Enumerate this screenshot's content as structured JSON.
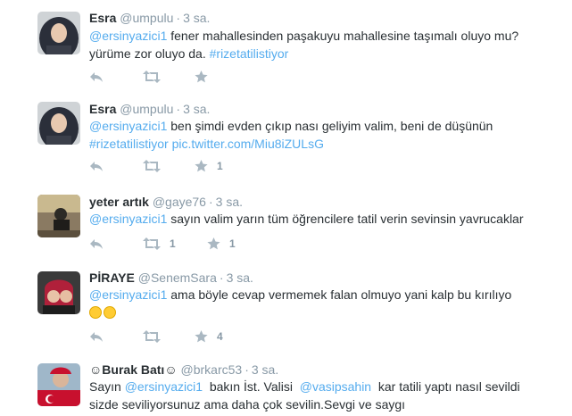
{
  "tweets": [
    {
      "fullname": "Esra",
      "username": "@umpulu",
      "time": "3 sa.",
      "line1": {
        "mention": "@ersinyazici1",
        "text": " fener mahallesinden paşakuyu mahallesine taşımalı oluyo mu?"
      },
      "line2": {
        "text": "yürüme zor oluyo da. ",
        "hashtag": "#rizetatilistiyor"
      },
      "retweets": "",
      "favorites": ""
    },
    {
      "fullname": "Esra",
      "username": "@umpulu",
      "time": "3 sa.",
      "line1": {
        "mention": "@ersinyazici1",
        "text": " ben şimdi evden çıkıp nası geliyim valim, beni de düşünün"
      },
      "line2": {
        "hashtag": "#rizetatilistiyor",
        "link": "pic.twitter.com/Miu8iZULsG"
      },
      "retweets": "",
      "favorites": "1"
    },
    {
      "fullname": "yeter artık",
      "username": "@gaye76",
      "time": "3 sa.",
      "line1": {
        "mention": "@ersinyazici1",
        "text": " sayın valim yarın tüm öğrencilere tatil verin sevinsin yavrucaklar"
      },
      "retweets": "1",
      "favorites": "1"
    },
    {
      "fullname": "PİRAYE",
      "username": "@SenemSara",
      "time": "3 sa.",
      "line1": {
        "mention": "@ersinyazici1",
        "text": " ama böyle cevap vermemek falan olmuyo yani kalp bu kırılıyo"
      },
      "retweets": "",
      "favorites": "4"
    },
    {
      "fullname": "☺Burak Batı☺",
      "username": "@brkarc53",
      "time": "3 sa.",
      "line1": {
        "prefix": "Sayın ",
        "mention": "@ersinyazici1",
        "mid": "  bakın İst. Valisi  ",
        "mention2": "@vasipsahin",
        "text": "  kar tatili yaptı nasıl sevildi"
      },
      "line2": {
        "text": "sizde seviliyorsunuz ama daha çok sevilin.Sevgi ve saygı"
      }
    }
  ],
  "icons": {
    "reply": "reply-icon",
    "retweet": "retweet-icon",
    "favorite": "star-icon"
  },
  "colors": {
    "link": "#55acee",
    "muted": "#8899a6",
    "text": "#292f33"
  }
}
